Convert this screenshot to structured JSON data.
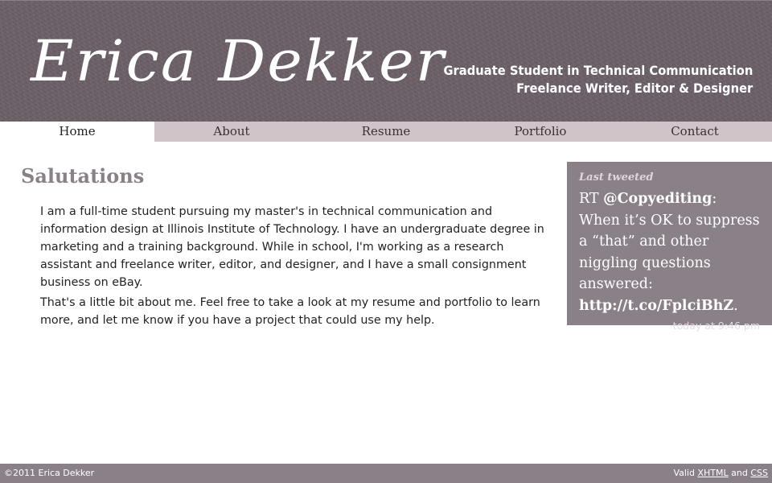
{
  "header": {
    "logo_text": "Erica Dekker",
    "tagline_line1": "Graduate Student in Technical Communication",
    "tagline_line2": "Freelance Writer, Editor & Designer"
  },
  "nav": {
    "items": [
      {
        "label": "Home",
        "active": true
      },
      {
        "label": "About",
        "active": false
      },
      {
        "label": "Resume",
        "active": false
      },
      {
        "label": "Portfolio",
        "active": false
      },
      {
        "label": "Contact",
        "active": false
      }
    ]
  },
  "main": {
    "title": "Salutations",
    "paragraph1": "I am a full-time student pursuing my master's in technical communication and information design at Illinois Institute of Technology. I have an undergraduate degree in marketing and a training background. While in school, I'm working as a research assistant and freelance writer, editor, and designer, and I have a small consignment business on eBay.",
    "paragraph2": "That's a little bit about me. Feel free to take a look at my resume and portfolio to learn more, and let me know if you have a project that could use my help."
  },
  "tweet": {
    "heading": "Last tweeted",
    "prefix": "RT ",
    "handle": "@Copyediting",
    "body": ": When it’s OK to suppress a “that” and other niggling questions answered: ",
    "link": "http://t.co/FplciBhZ",
    "suffix": ".",
    "time": "today at 9:46 pm"
  },
  "footer": {
    "copyright": "©2011 Erica Dekker",
    "valid_prefix": "Valid ",
    "xhtml_label": "XHTML",
    "and_text": " and ",
    "css_label": "CSS"
  },
  "colors": {
    "header_bg": "#6a5f66",
    "nav_bg": "#d1c4c8",
    "accent": "#8a8087",
    "text": "#222222"
  }
}
